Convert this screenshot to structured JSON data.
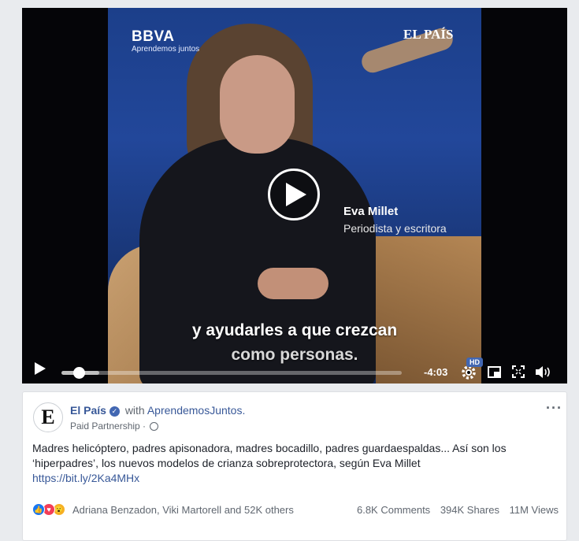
{
  "video": {
    "brand_left": "BBVA",
    "brand_left_sub": "Aprendemos juntos",
    "brand_right": "EL PAÍS",
    "speaker_name": "Eva Millet",
    "speaker_role": "Periodista y escritora",
    "caption_line1": "y ayudarles a que crezcan",
    "caption_line2": "como personas.",
    "progress_fraction": 0.05,
    "loaded_fraction": 0.11,
    "time_remaining": "-4:03",
    "hd_label": "HD"
  },
  "post": {
    "avatar_letter": "E",
    "page_name": "El País",
    "with_word": "with",
    "partner": "AprendemosJuntos.",
    "sub_label": "Paid Partnership ·",
    "more_label": "···",
    "text": "Madres helicóptero, padres apisonadora, madres bocadillo, padres guardaespaldas... Así son los ‘hiperpadres’, los nuevos modelos de crianza sobreprotectora, según Eva Millet",
    "link": "https://bit.ly/2Ka4MHx",
    "reactors": "Adriana Benzadon, Viki Martorell and 52K others",
    "comments": "6.8K Comments",
    "shares": "394K Shares",
    "views": "11M Views"
  },
  "icons": {
    "play": "play-icon",
    "settings": "gear-icon",
    "pip": "picture-in-picture-icon",
    "fullscreen": "fullscreen-icon",
    "volume": "volume-icon",
    "verified": "verified-badge-icon",
    "globe": "globe-icon",
    "reactions": [
      "like-icon",
      "love-icon",
      "wow-icon"
    ]
  },
  "colors": {
    "link": "#385898",
    "facebook_blue": "#4267b2",
    "like": "#1877f2",
    "love": "#f33e58",
    "wow": "#f7b125"
  }
}
